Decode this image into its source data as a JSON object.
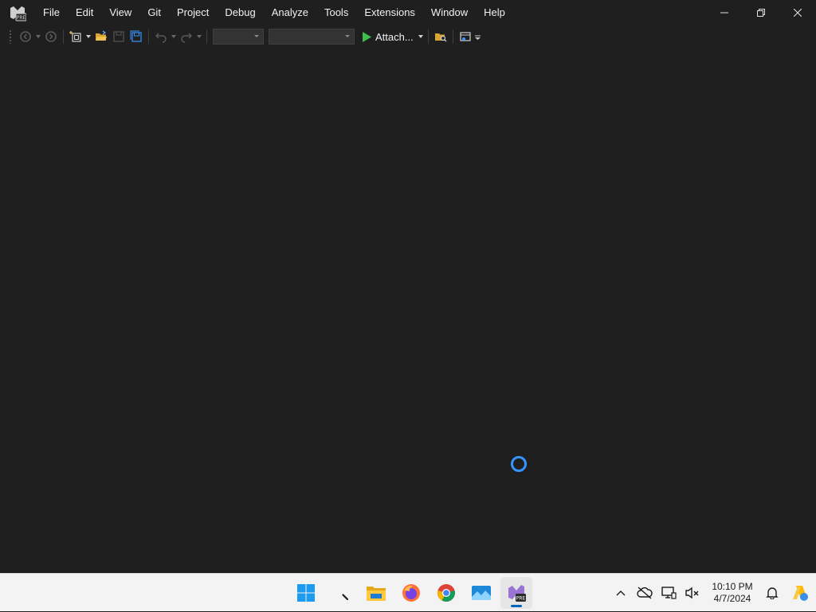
{
  "menu": {
    "items": [
      {
        "id": "file",
        "label": "File"
      },
      {
        "id": "edit",
        "label": "Edit"
      },
      {
        "id": "view",
        "label": "View"
      },
      {
        "id": "git",
        "label": "Git"
      },
      {
        "id": "project",
        "label": "Project"
      },
      {
        "id": "debug",
        "label": "Debug"
      },
      {
        "id": "analyze",
        "label": "Analyze"
      },
      {
        "id": "tools",
        "label": "Tools"
      },
      {
        "id": "extensions",
        "label": "Extensions"
      },
      {
        "id": "window",
        "label": "Window"
      },
      {
        "id": "help",
        "label": "Help"
      }
    ]
  },
  "app": {
    "logo_badge": "PRE",
    "accent_color": "#3794ff",
    "logo_color": "#9a73d6"
  },
  "toolbar": {
    "attach_label": "Attach...",
    "config_combo_value": "",
    "platform_combo_value": ""
  },
  "taskbar": {
    "apps": [
      {
        "id": "start",
        "icon": "windows-start-icon"
      },
      {
        "id": "search",
        "icon": "search-icon"
      },
      {
        "id": "explorer",
        "icon": "folder-icon"
      },
      {
        "id": "firefox",
        "icon": "firefox-icon"
      },
      {
        "id": "chrome",
        "icon": "chrome-icon"
      },
      {
        "id": "photos",
        "icon": "photos-icon"
      },
      {
        "id": "visualstudio",
        "icon": "visual-studio-preview-icon"
      }
    ],
    "clock": {
      "time": "10:10 PM",
      "date": "4/7/2024"
    }
  }
}
